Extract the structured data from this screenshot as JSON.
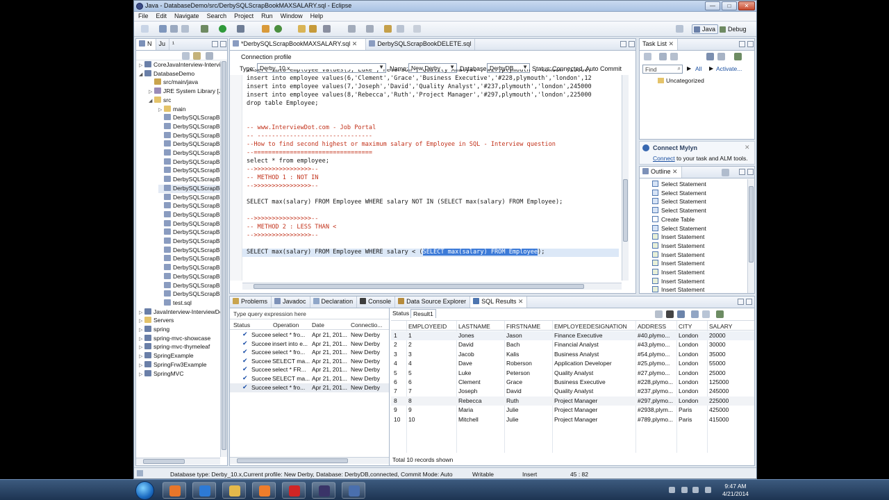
{
  "window": {
    "title": "Java - DatabaseDemo/src/DerbySQLScrapBookMAXSALARY.sql - Eclipse",
    "controls": [
      "—",
      "□",
      "✕"
    ]
  },
  "menu": [
    "File",
    "Edit",
    "Navigate",
    "Search",
    "Project",
    "Run",
    "Window",
    "Help"
  ],
  "perspectives": {
    "java": "Java",
    "debug": "Debug"
  },
  "explorer": {
    "tabs": [
      "N",
      "Ju",
      "¹"
    ],
    "items": [
      {
        "label": "CoreJavaInterview-Interview",
        "indent": 0,
        "twisty": "▷",
        "icon": "project-icon"
      },
      {
        "label": "DatabaseDemo",
        "indent": 0,
        "twisty": "◢",
        "icon": "project-icon"
      },
      {
        "label": "src/main/java",
        "indent": 1,
        "twisty": "",
        "icon": "package-folder-icon"
      },
      {
        "label": "JRE System Library [Java",
        "indent": 1,
        "twisty": "▷",
        "icon": "library-icon"
      },
      {
        "label": "src",
        "indent": 1,
        "twisty": "◢",
        "icon": "folder-icon"
      },
      {
        "label": "main",
        "indent": 2,
        "twisty": "▷",
        "icon": "folder-icon"
      },
      {
        "label": "DerbySQLScrapBoo",
        "indent": 2,
        "twisty": "",
        "icon": "sql-file-icon"
      },
      {
        "label": "DerbySQLScrapBoo",
        "indent": 2,
        "twisty": "",
        "icon": "sql-file-icon"
      },
      {
        "label": "DerbySQLScrapBoo",
        "indent": 2,
        "twisty": "",
        "icon": "sql-file-icon"
      },
      {
        "label": "DerbySQLScrapBoo",
        "indent": 2,
        "twisty": "",
        "icon": "sql-file-icon"
      },
      {
        "label": "DerbySQLScrapBoo",
        "indent": 2,
        "twisty": "",
        "icon": "sql-file-icon"
      },
      {
        "label": "DerbySQLScrapBoo",
        "indent": 2,
        "twisty": "",
        "icon": "sql-file-icon"
      },
      {
        "label": "DerbySQLScrapBoo",
        "indent": 2,
        "twisty": "",
        "icon": "sql-file-icon"
      },
      {
        "label": "DerbySQLScrapBoo",
        "indent": 2,
        "twisty": "",
        "icon": "sql-file-icon"
      },
      {
        "label": "DerbySQLScrapBoo",
        "indent": 2,
        "twisty": "",
        "icon": "sql-file-icon",
        "selected": true
      },
      {
        "label": "DerbySQLScrapBoo",
        "indent": 2,
        "twisty": "",
        "icon": "sql-file-icon"
      },
      {
        "label": "DerbySQLScrapBoo",
        "indent": 2,
        "twisty": "",
        "icon": "sql-file-icon"
      },
      {
        "label": "DerbySQLScrapBoo",
        "indent": 2,
        "twisty": "",
        "icon": "sql-file-icon"
      },
      {
        "label": "DerbySQLScrapBoo",
        "indent": 2,
        "twisty": "",
        "icon": "sql-file-icon"
      },
      {
        "label": "DerbySQLScrapBoo",
        "indent": 2,
        "twisty": "",
        "icon": "sql-file-icon"
      },
      {
        "label": "DerbySQLScrapBoo",
        "indent": 2,
        "twisty": "",
        "icon": "sql-file-icon"
      },
      {
        "label": "DerbySQLScrapBoo",
        "indent": 2,
        "twisty": "",
        "icon": "sql-file-icon"
      },
      {
        "label": "DerbySQLScrapBoo",
        "indent": 2,
        "twisty": "",
        "icon": "sql-file-icon"
      },
      {
        "label": "DerbySQLScrapBoo",
        "indent": 2,
        "twisty": "",
        "icon": "sql-file-icon"
      },
      {
        "label": "DerbySQLScrapBoo",
        "indent": 2,
        "twisty": "",
        "icon": "sql-file-icon"
      },
      {
        "label": "DerbySQLScrapBoo",
        "indent": 2,
        "twisty": "",
        "icon": "sql-file-icon"
      },
      {
        "label": "DerbySQLScrapBoo",
        "indent": 2,
        "twisty": "",
        "icon": "sql-file-icon"
      },
      {
        "label": "test.sql",
        "indent": 2,
        "twisty": "",
        "icon": "sql-file-icon"
      },
      {
        "label": "JavaInterview-InterviewDot",
        "indent": 0,
        "twisty": "▷",
        "icon": "project-icon"
      },
      {
        "label": "Servers",
        "indent": 0,
        "twisty": "▷",
        "icon": "folder-icon"
      },
      {
        "label": "spring",
        "indent": 0,
        "twisty": "▷",
        "icon": "project-icon"
      },
      {
        "label": "spring-mvc-showcase",
        "indent": 0,
        "twisty": "▷",
        "icon": "project-icon"
      },
      {
        "label": "spring-mvc-thymeleaf",
        "indent": 0,
        "twisty": "▷",
        "icon": "project-icon"
      },
      {
        "label": "SpringExample",
        "indent": 0,
        "twisty": "▷",
        "icon": "project-icon"
      },
      {
        "label": "SpringFrw3Example",
        "indent": 0,
        "twisty": "▷",
        "icon": "project-icon"
      },
      {
        "label": "SpringMVC",
        "indent": 0,
        "twisty": "▷",
        "icon": "project-icon"
      }
    ]
  },
  "editor": {
    "tabs": [
      {
        "label": "*DerbySQLScrapBookMAXSALARY.sql",
        "active": true
      },
      {
        "label": "DerbySQLScrapBookDELETE.sql",
        "active": false
      }
    ],
    "connection_profile_label": "Connection profile",
    "type_label": "Type:",
    "type_value": "Derby_10.x",
    "name_label": "Name:",
    "name_value": "New Derby",
    "database_label": "Database:",
    "database_value": "DerbyDB",
    "status_label": "Status:",
    "status_value": "Connected, Auto Commit",
    "lines": [
      {
        "text": "insert into employee values(5,'Luke','Peterson','Quality Analyst','#27,plymouth','london',25000)",
        "kind": "code"
      },
      {
        "text": "insert into employee values(6,'Clement','Grace','Business Executive','#228,plymouth','london',12",
        "kind": "code"
      },
      {
        "text": "insert into employee values(7,'Joseph','David','Quality Analyst','#237,plymouth','london',245000",
        "kind": "code"
      },
      {
        "text": "insert into employee values(8,'Rebecca','Ruth','Project Manager','#297,plymouth','london',225000",
        "kind": "code"
      },
      {
        "text": "drop table Employee;",
        "kind": "code"
      },
      {
        "text": "",
        "kind": "code"
      },
      {
        "text": "",
        "kind": "code"
      },
      {
        "text": "-- www.InterviewDot.com - Job Portal",
        "kind": "comment"
      },
      {
        "text": "-- --------------------------------",
        "kind": "comment"
      },
      {
        "text": "--How to find second highest or maximum salary of Employee in SQL - Interview question",
        "kind": "comment"
      },
      {
        "text": "--=================================",
        "kind": "comment"
      },
      {
        "text": "select * from employee;",
        "kind": "code"
      },
      {
        "text": "-->>>>>>>>>>>>>>>>--",
        "kind": "comment"
      },
      {
        "text": "-- METHOD 1 : NOT IN",
        "kind": "comment"
      },
      {
        "text": "-->>>>>>>>>>>>>>>>--",
        "kind": "comment"
      },
      {
        "text": "",
        "kind": "code"
      },
      {
        "text": "SELECT max(salary) FROM Employee WHERE salary NOT IN (SELECT max(salary) FROM Employee);",
        "kind": "code"
      },
      {
        "text": "",
        "kind": "code"
      },
      {
        "text": "-->>>>>>>>>>>>>>>>--",
        "kind": "comment"
      },
      {
        "text": "-- METHOD 2 : LESS THAN <",
        "kind": "comment"
      },
      {
        "text": "-->>>>>>>>>>>>>>>>--",
        "kind": "comment"
      },
      {
        "text": "",
        "kind": "code"
      },
      {
        "text": "SELECT max(salary) FROM Employee WHERE salary < (",
        "kind": "current",
        "selected": "SELECT max(salary) FROM Employee",
        "after": ");"
      }
    ]
  },
  "tasklist": {
    "title": "Task List",
    "find_placeholder": "Find",
    "all_label": "All",
    "activate_label": "Activate...",
    "category": "Uncategorized"
  },
  "mylyn": {
    "title": "Connect Mylyn",
    "link": "Connect",
    "text": " to your task and ALM tools."
  },
  "outline": {
    "title": "Outline",
    "items": [
      {
        "label": "Select Statement",
        "icon": "statement-icon"
      },
      {
        "label": "Select Statement",
        "icon": "statement-icon"
      },
      {
        "label": "Select Statement",
        "icon": "statement-icon"
      },
      {
        "label": "Select Statement",
        "icon": "statement-icon"
      },
      {
        "label": "Create Table",
        "icon": "table-icon"
      },
      {
        "label": "Select Statement",
        "icon": "statement-icon"
      },
      {
        "label": "Insert Statement",
        "icon": "insert-icon"
      },
      {
        "label": "Insert Statement",
        "icon": "insert-icon"
      },
      {
        "label": "Insert Statement",
        "icon": "insert-icon"
      },
      {
        "label": "Insert Statement",
        "icon": "insert-icon"
      },
      {
        "label": "Insert Statement",
        "icon": "insert-icon"
      },
      {
        "label": "Insert Statement",
        "icon": "insert-icon"
      },
      {
        "label": "Insert Statement",
        "icon": "insert-icon"
      }
    ]
  },
  "bottom_tabs": [
    "Problems",
    "Javadoc",
    "Declaration",
    "Console",
    "Data Source Explorer",
    "SQL Results"
  ],
  "sql_history": {
    "filter_placeholder": "Type query expression here",
    "columns": [
      "Status",
      "Operation",
      "Date",
      "Connectio..."
    ],
    "rows": [
      {
        "status": "Succee",
        "operation": "select * fro...",
        "date": "Apr 21, 201...",
        "connection": "New Derby"
      },
      {
        "status": "Succee",
        "operation": "insert into e...",
        "date": "Apr 21, 201...",
        "connection": "New Derby"
      },
      {
        "status": "Succee",
        "operation": "select * fro...",
        "date": "Apr 21, 201...",
        "connection": "New Derby"
      },
      {
        "status": "Succee",
        "operation": "SELECT ma...",
        "date": "Apr 21, 201...",
        "connection": "New Derby"
      },
      {
        "status": "Succee",
        "operation": "select * FR...",
        "date": "Apr 21, 201...",
        "connection": "New Derby"
      },
      {
        "status": "Succee",
        "operation": "SELECT ma...",
        "date": "Apr 21, 201...",
        "connection": "New Derby"
      },
      {
        "status": "Succee",
        "operation": "select * fro...",
        "date": "Apr 21, 201...",
        "connection": "New Derby"
      }
    ]
  },
  "results": {
    "tabs": [
      "Status",
      "Result1"
    ],
    "columns": [
      "EMPLOYEEID",
      "LASTNAME",
      "FIRSTNAME",
      "EMPLOYEEDESIGNATION",
      "ADDRESS",
      "CITY",
      "SALARY"
    ],
    "rows": [
      [
        "1",
        "Jones",
        "Jason",
        "Finance Executive",
        "#40,plymo...",
        "London",
        "20000"
      ],
      [
        "2",
        "David",
        "Bach",
        "Financial Analyst",
        "#43,plymo...",
        "London",
        "30000"
      ],
      [
        "3",
        "Jacob",
        "Kalis",
        "Business Analyst",
        "#54,plymo...",
        "London",
        "35000"
      ],
      [
        "4",
        "Dave",
        "Roberson",
        "Application Developer",
        "#25,plymo...",
        "London",
        "55000"
      ],
      [
        "5",
        "Luke",
        "Peterson",
        "Quality Analyst",
        "#27,plymo...",
        "London",
        "25000"
      ],
      [
        "6",
        "Clement",
        "Grace",
        "Business Executive",
        "#228,plymo...",
        "London",
        "125000"
      ],
      [
        "7",
        "Joseph",
        "David",
        "Quality Analyst",
        "#237,plymo...",
        "London",
        "245000"
      ],
      [
        "8",
        "Rebecca",
        "Ruth",
        "Project Manager",
        "#297,plymo...",
        "London",
        "225000"
      ],
      [
        "9",
        "Maria",
        "Julie",
        "Project Manager",
        "#2938,plym...",
        "Paris",
        "425000"
      ],
      [
        "10",
        "Mitchell",
        "Julie",
        "Project Manager",
        "#789,plymo...",
        "Paris",
        "415000"
      ]
    ],
    "footer": "Total 10 records shown"
  },
  "statusbar": {
    "info": "Database type: Derby_10.x,Current profile: New Derby, Database: DerbyDB,connected, Commit Mode: Auto",
    "writable": "Writable",
    "insert": "Insert",
    "position": "45 : 82"
  },
  "taskbar": {
    "time": "9:47 AM",
    "date": "4/21/2014",
    "apps": [
      {
        "icon": "firefox-icon",
        "color": "#e8762a"
      },
      {
        "icon": "internet-explorer-icon",
        "color": "#2d7ad6"
      },
      {
        "icon": "file-explorer-icon",
        "color": "#e5b94b"
      },
      {
        "icon": "media-player-icon",
        "color": "#ef7d2b"
      },
      {
        "icon": "acrobat-icon",
        "color": "#d12525"
      },
      {
        "icon": "eclipse-icon",
        "color": "#3a3468"
      },
      {
        "icon": "save-disk-icon",
        "color": "#4a6fae"
      }
    ]
  },
  "colors": {
    "comment": "#c2311a",
    "selection": "#3d7bd8",
    "current_line": "#dce8f7",
    "link": "#1a4fa0"
  }
}
